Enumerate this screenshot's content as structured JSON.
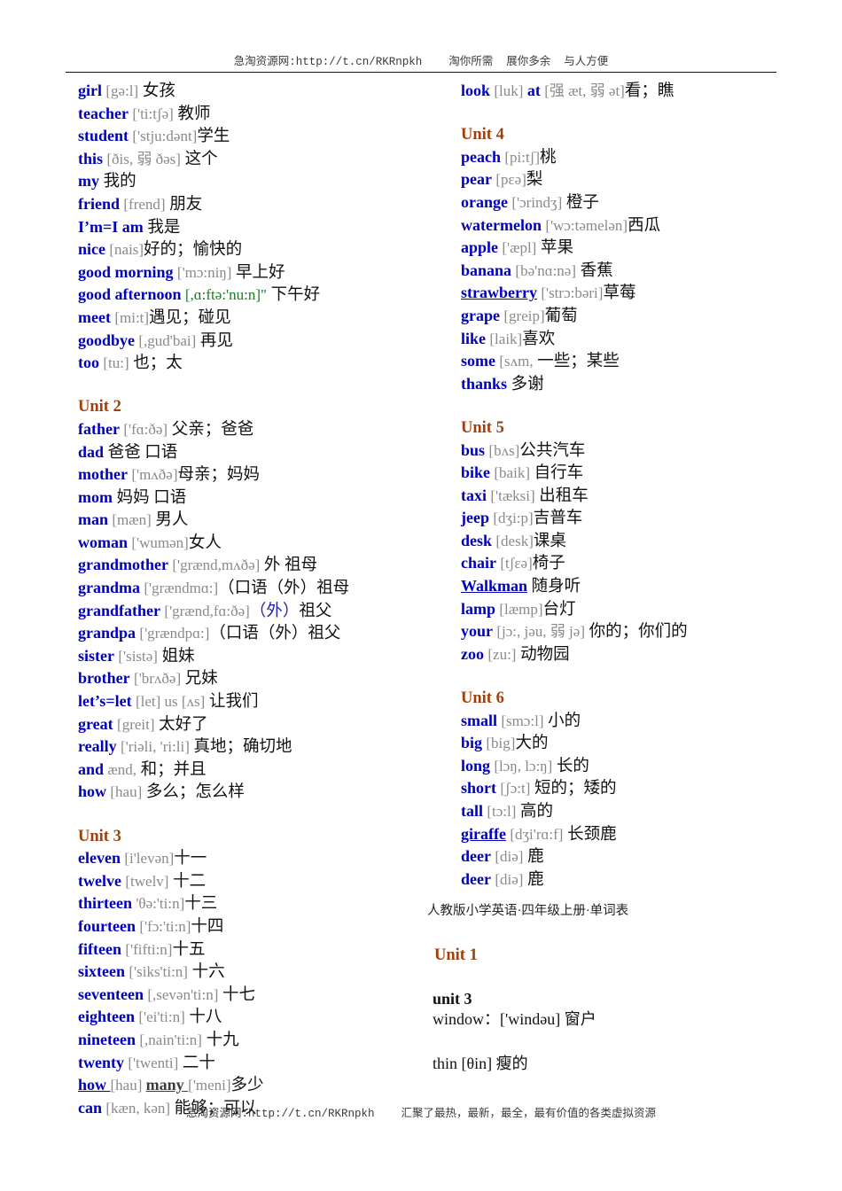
{
  "header": {
    "banner": "急淘资源网:http://t.cn/RKRnpkh    淘你所需  展你多余  与人方便"
  },
  "footer": {
    "banner": "急淘资源网:http://t.cn/RKRnpkh    汇聚了最热，最新，最全，最有价值的各类虚拟资源"
  },
  "left_column": {
    "entries": [
      {
        "word": "girl",
        "phon": "[gə:l]",
        "cn": " 女孩"
      },
      {
        "word": "teacher",
        "phon": "['ti:tʃə]",
        "cn": " 教师"
      },
      {
        "word": "student",
        "phon": "['stju:dənt]",
        "cn": "学生"
      },
      {
        "word": "this",
        "phon": "[ðis, 弱 ðəs]",
        "cn": " 这个"
      },
      {
        "word": "my",
        "phon": "",
        "cn": " 我的"
      },
      {
        "word": "friend",
        "phon": "[frend]",
        "cn": " 朋友"
      },
      {
        "word": "I’m=I am",
        "phon": "",
        "cn": " 我是"
      },
      {
        "word": "nice",
        "phon": "[nais]",
        "cn": "好的；愉快的"
      },
      {
        "word": "good morning",
        "phon": "['mɔ:niŋ]",
        "cn": " 早上好"
      },
      {
        "word": "good afternoon",
        "phon": "[,ɑ:ftə:'nu:n]\"",
        "phon_color": "green",
        "cn": " 下午好"
      },
      {
        "word": "meet",
        "phon": "[mi:t]",
        "cn": "遇见；碰见"
      },
      {
        "word": "goodbye",
        "phon": "[,gud'bai]",
        "cn": " 再见"
      },
      {
        "word": "too",
        "phon": "[tu:]",
        "cn": " 也；太"
      }
    ],
    "unit2": {
      "title": "Unit 2",
      "entries": [
        {
          "word": "father",
          "phon": "['fɑ:ðə]",
          "cn": " 父亲；爸爸"
        },
        {
          "word": "dad",
          "phon": "",
          "cn": " 爸爸 口语"
        },
        {
          "word": "mother",
          "phon": "['mʌðə]",
          "cn": "母亲；妈妈"
        },
        {
          "word": "mom",
          "phon": "",
          "cn": " 妈妈 口语"
        },
        {
          "word": "man",
          "phon": "[mæn]",
          "cn": " 男人"
        },
        {
          "word": "woman",
          "phon": "['wumən]",
          "cn": "女人"
        },
        {
          "word": "grandmother",
          "phon": "['grænd,mʌðə]",
          "cn": " 外 祖母"
        },
        {
          "word": "grandma",
          "phon": "['grændmɑ:]",
          "cn": "（口语（外）祖母"
        },
        {
          "word": "grandfather",
          "phon": "['grænd,fɑ:ðə]",
          "cn": "（外）祖父",
          "cn_paren_blue": true
        },
        {
          "word": "grandpa",
          "phon": "['grændpɑ:]",
          "cn": "（口语（外）祖父"
        },
        {
          "word": "sister",
          "phon": "['sistə]",
          "cn": " 姐妹"
        },
        {
          "word": "brother",
          "phon": "['brʌðə]",
          "cn": " 兄妹"
        },
        {
          "word": "let’s=let",
          "phon": "[let]  us [ʌs]",
          "cn": " 让我们"
        },
        {
          "word": "great",
          "phon": "[greit]",
          "cn": " 太好了"
        },
        {
          "word": "really",
          "phon": "['riəli, 'ri:li]",
          "cn": " 真地；确切地"
        },
        {
          "word": "and",
          "phon": "ænd,",
          "cn": " 和；并且"
        },
        {
          "word": "how",
          "phon": "[hau]",
          "cn": " 多么；怎么样"
        }
      ]
    },
    "unit3": {
      "title": "Unit 3",
      "entries": [
        {
          "word": "eleven",
          "phon": "[i'levən]",
          "cn": "十一"
        },
        {
          "word": "twelve",
          "phon": "[twelv]",
          "cn": " 十二"
        },
        {
          "word": "thirteen",
          "phon": "'θə:'ti:n]",
          "cn": "十三"
        },
        {
          "word": "fourteen",
          "phon": "['fɔ:'ti:n]",
          "cn": "十四"
        },
        {
          "word": "fifteen",
          "phon": "['fifti:n]",
          "cn": "十五"
        },
        {
          "word": "sixteen",
          "phon": "['siks'ti:n]",
          "cn": " 十六"
        },
        {
          "word": "seventeen",
          "phon": "[,sevən'ti:n]",
          "cn": " 十七"
        },
        {
          "word": "eighteen",
          "phon": "['ei'ti:n]",
          "cn": " 十八"
        },
        {
          "word": "nineteen",
          "phon": "[,nain'ti:n]",
          "cn": " 十九"
        },
        {
          "word": "twenty",
          "phon": "['twenti]",
          "cn": " 二十"
        },
        {
          "word": "how ",
          "word_underline": true,
          "phon": "[hau] ",
          "word2": " many ",
          "phon2": "['meni]",
          "cn": "多少"
        },
        {
          "word": "can",
          "phon": "[kæn, kən]",
          "cn": " 能够；可以"
        }
      ]
    }
  },
  "right_column": {
    "entries": [
      {
        "word": "look",
        "phon": "[luk]",
        "word2": "at",
        "phon2": "[强 æt, 弱 ət]",
        "cn": "看；瞧"
      }
    ],
    "unit4": {
      "title": "Unit 4",
      "entries": [
        {
          "word": "peach",
          "phon": "[pi:tʃ]",
          "cn": "桃"
        },
        {
          "word": "pear",
          "phon": "[pɛə]",
          "cn": "梨"
        },
        {
          "word": "orange",
          "phon": "['ɔrindʒ]",
          "cn": " 橙子"
        },
        {
          "word": "watermelon",
          "phon": "['wɔ:təmelən]",
          "cn": "西瓜"
        },
        {
          "word": "apple",
          "phon": "['æpl]",
          "cn": " 苹果"
        },
        {
          "word": "banana",
          "phon": "[bə'nɑ:nə]",
          "cn": " 香蕉"
        },
        {
          "word": "strawberry",
          "word_underline": true,
          "phon": "['strɔ:bəri]",
          "cn": "草莓"
        },
        {
          "word": "grape",
          "phon": " [greip]",
          "cn": "葡萄"
        },
        {
          "word": "like",
          "phon": "[laik]",
          "cn": "喜欢"
        },
        {
          "word": "some",
          "phon": "[sʌm,",
          "cn": " 一些；某些"
        },
        {
          "word": "thanks",
          "phon": "",
          "cn": " 多谢"
        }
      ]
    },
    "unit5": {
      "title": "Unit 5",
      "entries": [
        {
          "word": "bus",
          "phon": "[bʌs]",
          "cn": "公共汽车"
        },
        {
          "word": "bike",
          "phon": "[baik]",
          "cn": " 自行车"
        },
        {
          "word": "taxi",
          "phon": "['tæksi]",
          "cn": " 出租车"
        },
        {
          "word": "jeep",
          "phon": "[dʒi:p]",
          "cn": "吉普车"
        },
        {
          "word": "desk",
          "phon": "[desk]",
          "cn": "课桌"
        },
        {
          "word": "chair",
          "phon": "[tʃɛə]",
          "cn": "椅子"
        },
        {
          "word": "Walkman",
          "word_underline": true,
          "phon": "",
          "cn": " 随身听"
        },
        {
          "word": "lamp",
          "phon": "[læmp]",
          "cn": "台灯"
        },
        {
          "word": "your",
          "phon": "[jɔ:, jəu, 弱 jə]",
          "cn": " 你的；你们的"
        },
        {
          "word": "zoo",
          "phon": "[zu:]",
          "cn": " 动物园"
        }
      ]
    },
    "unit6": {
      "title": "Unit 6",
      "entries": [
        {
          "word": "small",
          "phon": "[smɔ:l]",
          "cn": "  小的"
        },
        {
          "word": "big",
          "phon": "[big]",
          "cn": "大的"
        },
        {
          "word": "long",
          "phon": "[lɔŋ, lɔ:ŋ]",
          "cn": " 长的"
        },
        {
          "word": "short",
          "phon": "[ʃɔ:t]",
          "cn": "  短的；矮的"
        },
        {
          "word": "tall",
          "phon": "[tɔ:l]",
          "cn": " 高的"
        },
        {
          "word": "giraffe",
          "word_underline": true,
          "phon": "[dʒi'rɑ:f]",
          "cn": " 长颈鹿"
        },
        {
          "word": "deer",
          "phon": "[diə]",
          "cn": "  鹿"
        },
        {
          "word": "deer",
          "phon": "[diə]",
          "cn": "  鹿"
        }
      ]
    }
  },
  "bottom_block": {
    "caption": "人教版小学英语·四年级上册·单词表",
    "unit_title": "Unit 1",
    "sub_title": "unit 3",
    "line1": "window：['windəu] 窗户",
    "line2": "thin [θin] 瘦的"
  }
}
